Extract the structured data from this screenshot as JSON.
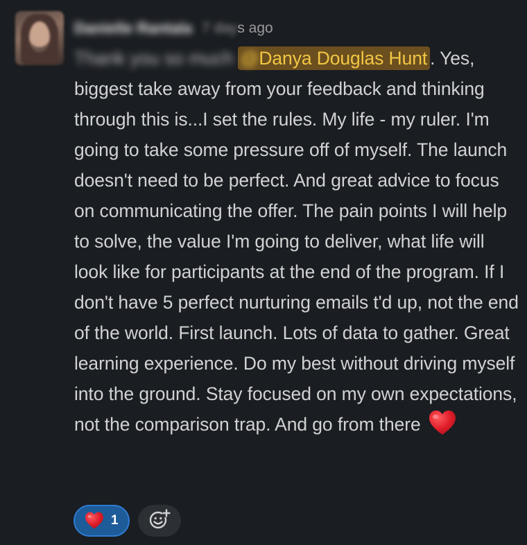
{
  "message": {
    "author": "Danielle Rantala",
    "timestamp_prefix": "7 day",
    "timestamp_suffix": "s ago",
    "lead_blurred": "Thank you so much",
    "mention_at": "@",
    "mention_name": "Danya Douglas Hunt",
    "body": ". Yes, biggest take away from your feedback and thinking through this is...I set the rules. My life - my ruler. I'm going to take some pressure off of myself. The launch doesn't need to be perfect. And great advice to focus on communicating the offer. The pain points I will help to solve, the value I'm going to deliver, what life will look like for participants at the end of the program. If I don't have 5 perfect nurturing emails t'd up, not the end of the world. First launch. Lots of data to gather. Great learning experience. Do my best without driving myself into the ground. Stay focused on my own expectations, not the comparison trap. And go from there",
    "trailing_emoji": "heart-icon"
  },
  "reactions": [
    {
      "emoji": "heart-icon",
      "count": "1"
    }
  ],
  "add_reaction_icon": "add-reaction-icon",
  "colors": {
    "background": "#1a1d21",
    "text": "#d1d2d3",
    "mention_bg": "#6b4f1f",
    "mention_text": "#f2c744",
    "reaction_bg": "#1d5c99",
    "reaction_border": "#2f7bd1",
    "heart": "#e01e2a"
  }
}
